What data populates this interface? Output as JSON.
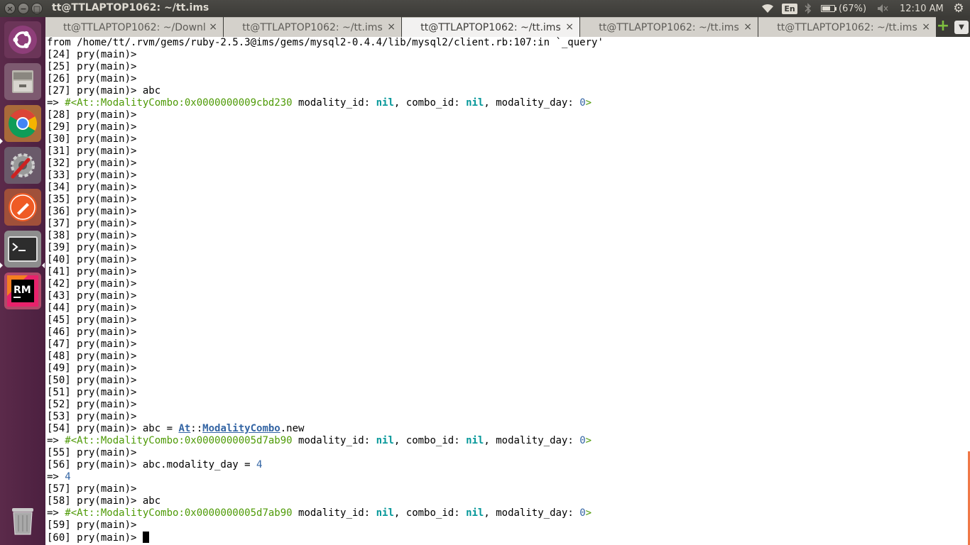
{
  "window": {
    "title": "tt@TTLAPTOP1062: ~/tt.ims",
    "close_glyph": "×",
    "minimize_glyph": "−",
    "maximize_glyph": "□"
  },
  "tray": {
    "wifi_icon": "wifi-icon",
    "language": "En",
    "bluetooth_icon": "bluetooth-icon",
    "battery_percent": "(67%)",
    "battery_level": 0.67,
    "volume_icon": "volume-muted-icon",
    "clock": "12:10 AM",
    "settings_glyph": "⚙"
  },
  "launcher": {
    "items": [
      {
        "name": "ubuntu-dash-icon"
      },
      {
        "name": "files-icon"
      },
      {
        "name": "chrome-icon"
      },
      {
        "name": "system-settings-icon"
      },
      {
        "name": "postman-icon"
      },
      {
        "name": "terminal-icon"
      },
      {
        "name": "rubymine-icon",
        "label": "RM"
      },
      {
        "name": "trash-icon"
      }
    ]
  },
  "tabs": [
    {
      "label": "tt@TTLAPTOP1062: ~/Downl…",
      "active": false
    },
    {
      "label": "tt@TTLAPTOP1062: ~/tt.ims",
      "active": false
    },
    {
      "label": "tt@TTLAPTOP1062: ~/tt.ims",
      "active": true
    },
    {
      "label": "tt@TTLAPTOP1062: ~/tt.ims",
      "active": false
    },
    {
      "label": "tt@TTLAPTOP1062: ~/tt.ims",
      "active": false
    }
  ],
  "tab_close_glyph": "×",
  "tab_add_glyph": "+",
  "tab_menu_glyph": "▼",
  "terminal": {
    "lines": [
      [
        {
          "t": "from /home/tt/.rvm/gems/ruby-2.5.3@ims/gems/mysql2-0.4.4/lib/mysql2/client.rb:107:in `_query'"
        }
      ],
      [
        {
          "t": "[24] pry(main)>"
        }
      ],
      [
        {
          "t": "[25] pry(main)>"
        }
      ],
      [
        {
          "t": "[26] pry(main)>"
        }
      ],
      [
        {
          "t": "[27] pry(main)> abc"
        }
      ],
      [
        {
          "t": "=> "
        },
        {
          "t": "#<At::ModalityCombo:0x0000000009cbd230",
          "c": "green"
        },
        {
          "t": " modality_id: "
        },
        {
          "t": "nil",
          "c": "cyan"
        },
        {
          "t": ", combo_id: "
        },
        {
          "t": "nil",
          "c": "cyan"
        },
        {
          "t": ", modality_day: "
        },
        {
          "t": "0",
          "c": "num"
        },
        {
          "t": ">",
          "c": "green"
        }
      ],
      [
        {
          "t": "[28] pry(main)>"
        }
      ],
      [
        {
          "t": "[29] pry(main)>"
        }
      ],
      [
        {
          "t": "[30] pry(main)>"
        }
      ],
      [
        {
          "t": "[31] pry(main)>"
        }
      ],
      [
        {
          "t": "[32] pry(main)>"
        }
      ],
      [
        {
          "t": "[33] pry(main)>"
        }
      ],
      [
        {
          "t": "[34] pry(main)>"
        }
      ],
      [
        {
          "t": "[35] pry(main)>"
        }
      ],
      [
        {
          "t": "[36] pry(main)>"
        }
      ],
      [
        {
          "t": "[37] pry(main)>"
        }
      ],
      [
        {
          "t": "[38] pry(main)>"
        }
      ],
      [
        {
          "t": "[39] pry(main)>"
        }
      ],
      [
        {
          "t": "[40] pry(main)>"
        }
      ],
      [
        {
          "t": "[41] pry(main)>"
        }
      ],
      [
        {
          "t": "[42] pry(main)>"
        }
      ],
      [
        {
          "t": "[43] pry(main)>"
        }
      ],
      [
        {
          "t": "[44] pry(main)>"
        }
      ],
      [
        {
          "t": "[45] pry(main)>"
        }
      ],
      [
        {
          "t": "[46] pry(main)>"
        }
      ],
      [
        {
          "t": "[47] pry(main)>"
        }
      ],
      [
        {
          "t": "[48] pry(main)>"
        }
      ],
      [
        {
          "t": "[49] pry(main)>"
        }
      ],
      [
        {
          "t": "[50] pry(main)>"
        }
      ],
      [
        {
          "t": "[51] pry(main)>"
        }
      ],
      [
        {
          "t": "[52] pry(main)>"
        }
      ],
      [
        {
          "t": "[53] pry(main)>"
        }
      ],
      [
        {
          "t": "[54] pry(main)> abc = "
        },
        {
          "t": "At",
          "c": "const"
        },
        {
          "t": "::"
        },
        {
          "t": "ModalityCombo",
          "c": "const"
        },
        {
          "t": ".new"
        }
      ],
      [
        {
          "t": "=> "
        },
        {
          "t": "#<At::ModalityCombo:0x0000000005d7ab90",
          "c": "green"
        },
        {
          "t": " modality_id: "
        },
        {
          "t": "nil",
          "c": "cyan"
        },
        {
          "t": ", combo_id: "
        },
        {
          "t": "nil",
          "c": "cyan"
        },
        {
          "t": ", modality_day: "
        },
        {
          "t": "0",
          "c": "num"
        },
        {
          "t": ">",
          "c": "green"
        }
      ],
      [
        {
          "t": "[55] pry(main)>"
        }
      ],
      [
        {
          "t": "[56] pry(main)> abc.modality_day = "
        },
        {
          "t": "4",
          "c": "num"
        }
      ],
      [
        {
          "t": "=> "
        },
        {
          "t": "4",
          "c": "num"
        }
      ],
      [
        {
          "t": "[57] pry(main)>"
        }
      ],
      [
        {
          "t": "[58] pry(main)> abc"
        }
      ],
      [
        {
          "t": "=> "
        },
        {
          "t": "#<At::ModalityCombo:0x0000000005d7ab90",
          "c": "green"
        },
        {
          "t": " modality_id: "
        },
        {
          "t": "nil",
          "c": "cyan"
        },
        {
          "t": ", combo_id: "
        },
        {
          "t": "nil",
          "c": "cyan"
        },
        {
          "t": ", modality_day: "
        },
        {
          "t": "0",
          "c": "num"
        },
        {
          "t": ">",
          "c": "green"
        }
      ],
      [
        {
          "t": "[59] pry(main)>"
        }
      ],
      [
        {
          "t": "[60] pry(main)> "
        }
      ]
    ]
  },
  "colors": {
    "launcher_bg": "#5b2a4a",
    "panel_bg": "#3c3b37",
    "ruby_object": "#4e9a06",
    "nil_value": "#06989a",
    "constant": "#3465a4",
    "scrollbar_accent": "#f07746"
  }
}
